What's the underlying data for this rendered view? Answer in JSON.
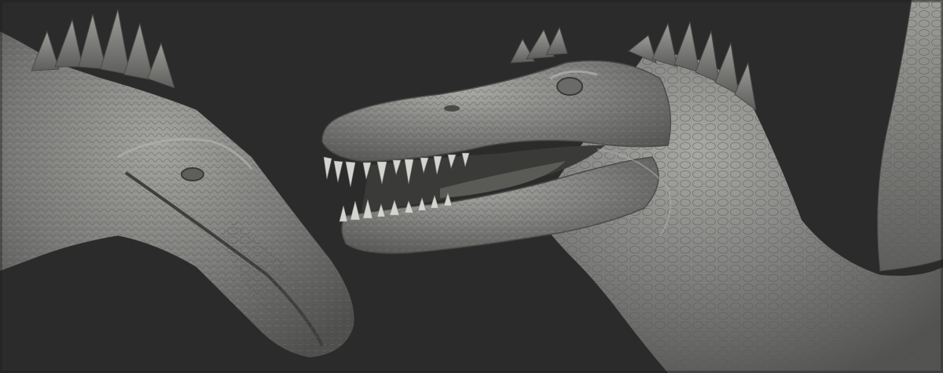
{
  "scene": {
    "subject_left": "spinosaurus-head-left-view",
    "subject_right": "spinosaurus-head-open-mouth-view",
    "colors": {
      "background": "#2b2b2b",
      "clay_base": "#7d7d7b",
      "clay_light": "#a9a9a6",
      "clay_dark": "#4a4a48",
      "teeth": "#d4d4d0",
      "mouth_shadow": "#3a3a38"
    }
  }
}
